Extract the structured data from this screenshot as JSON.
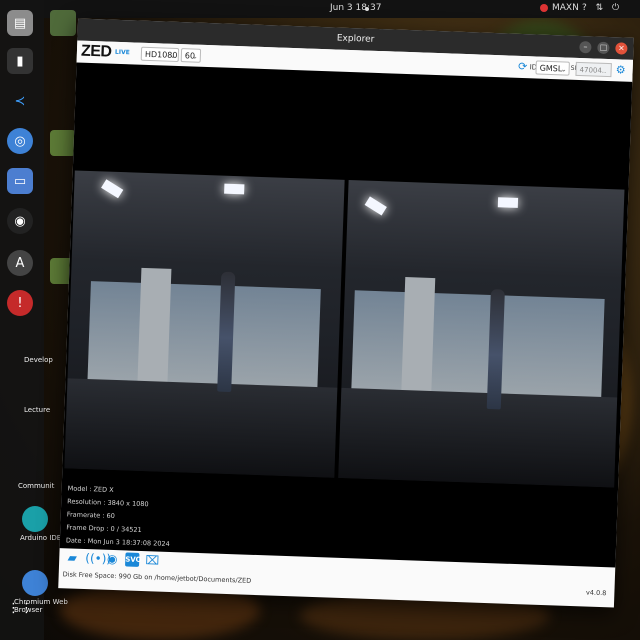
{
  "system": {
    "clock": "Jun 3  18:37",
    "status_text": "MAXN"
  },
  "dock": {
    "items": [
      {
        "icon": "files-icon",
        "label": ""
      },
      {
        "icon": "terminal-icon",
        "label": ""
      },
      {
        "icon": "vscode-icon",
        "label": ""
      },
      {
        "icon": "chromium-icon",
        "label": ""
      },
      {
        "icon": "app-window-icon",
        "label": ""
      },
      {
        "icon": "obs-icon",
        "label": ""
      },
      {
        "icon": "software-icon",
        "label": ""
      },
      {
        "icon": "error-icon",
        "label": ""
      }
    ],
    "desktop_labels": [
      "Develop",
      "Lecture",
      "Communit",
      "Arduino IDE",
      "Chromium Web Browser"
    ]
  },
  "window": {
    "title": "Explorer",
    "brand": "ZED",
    "brand_sub": "LIVE",
    "resolution_select": "HD1080",
    "fps_select": "60",
    "id_label": "ID",
    "id_select": "GMSL - 0",
    "sn_label": "SN",
    "sn_value": "47004..",
    "info": {
      "model": "Model : ZED X",
      "resolution": "Resolution : 3840 x 1080",
      "framerate": "Framerate : 60",
      "frame_drop": "Frame Drop : 0 / 34521",
      "date": "Date : Mon Jun 3 18:37:08 2024"
    },
    "disk_status": "Disk Free Space: 990 Gb  on /home/jetbot/Documents/ZED",
    "version": "v4.0.8"
  }
}
